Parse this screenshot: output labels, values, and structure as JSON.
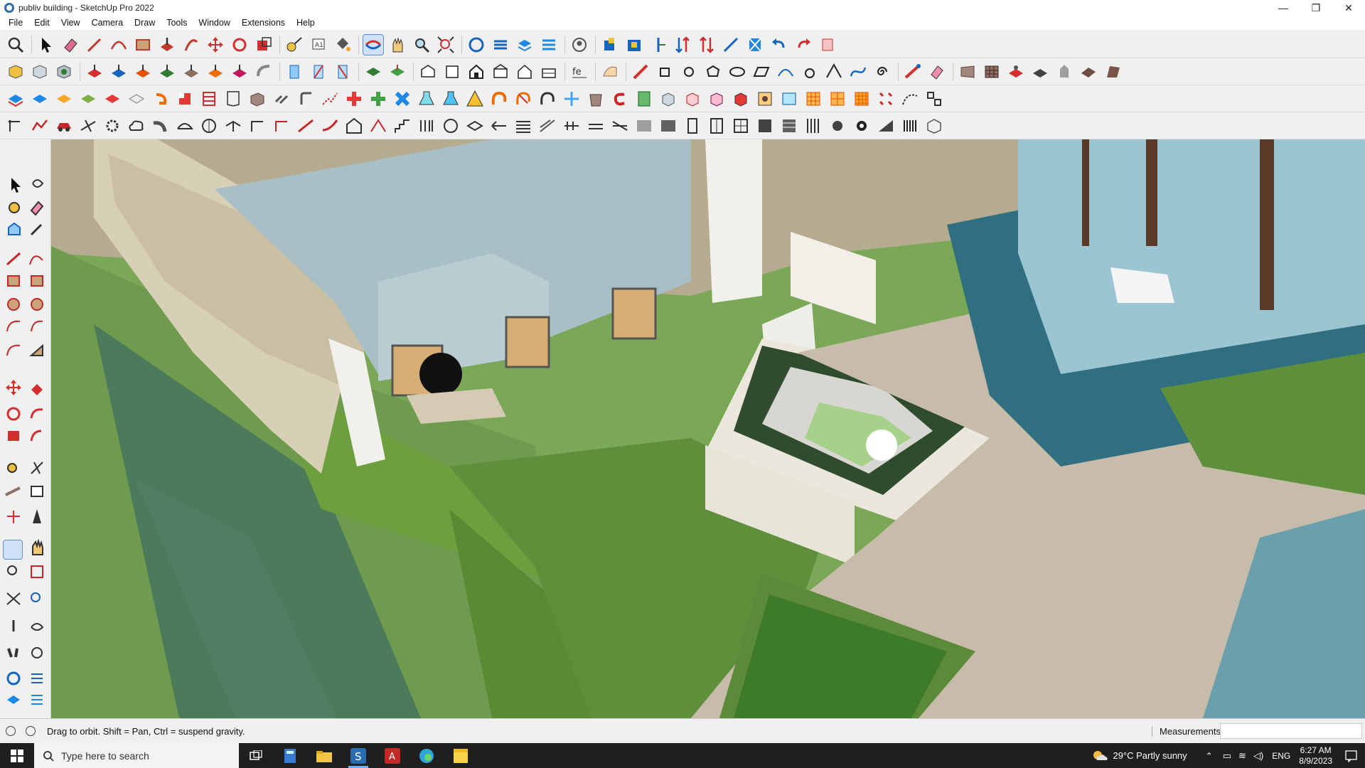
{
  "window": {
    "title": "publiv building - SketchUp Pro 2022",
    "min": "—",
    "max": "❐",
    "close": "✕"
  },
  "menu": [
    "File",
    "Edit",
    "View",
    "Camera",
    "Draw",
    "Tools",
    "Window",
    "Extensions",
    "Help"
  ],
  "status": {
    "message": "Drag to orbit. Shift = Pan, Ctrl = suspend gravity.",
    "measurements_label": "Measurements",
    "measurements_value": ""
  },
  "taskbar": {
    "search_placeholder": "Type here to search",
    "weather": "29°C  Partly sunny",
    "language": "ENG",
    "time": "6:27 AM",
    "date": "8/9/2023"
  }
}
